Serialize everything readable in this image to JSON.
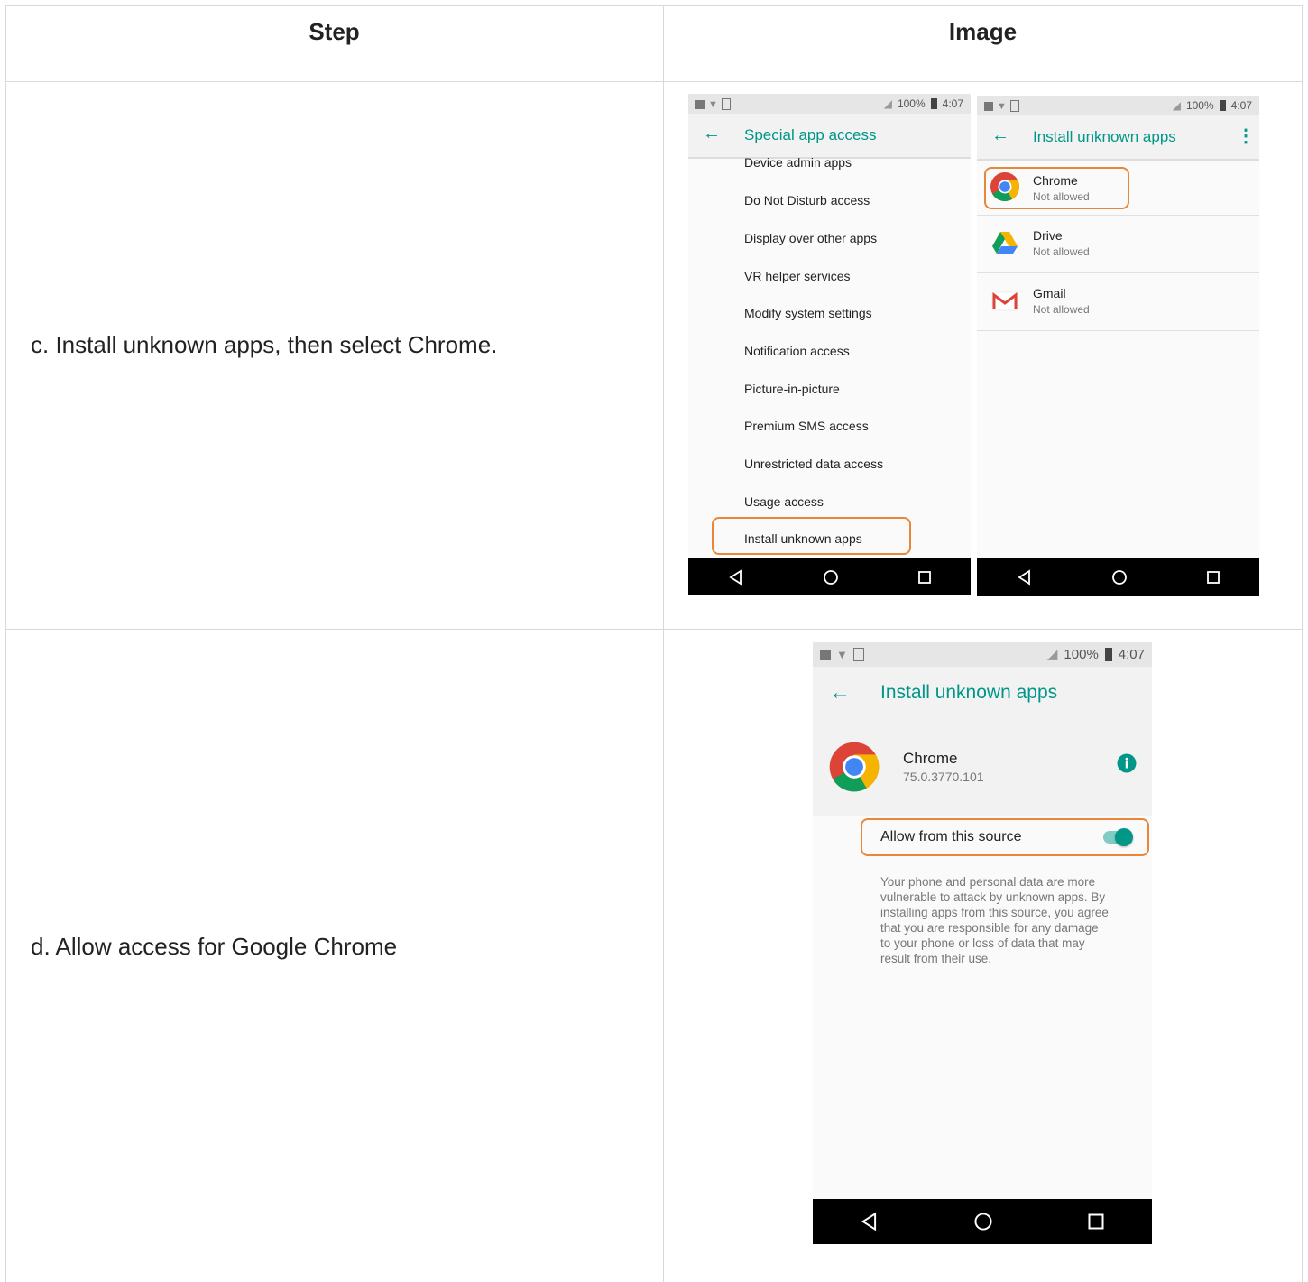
{
  "table": {
    "headers": [
      "Step",
      "Image"
    ],
    "rows": [
      {
        "step": "c.  Install unknown apps, then select Chrome."
      },
      {
        "step": "d. Allow access for Google Chrome"
      }
    ]
  },
  "status": {
    "battery": "100%",
    "time": "4:07"
  },
  "screen1": {
    "title": "Special app access",
    "items": [
      "Device admin apps",
      "Do Not Disturb access",
      "Display over other apps",
      "VR helper services",
      "Modify system settings",
      "Notification access",
      "Picture-in-picture",
      "Premium SMS access",
      "Unrestricted data access",
      "Usage access",
      "Install unknown apps"
    ]
  },
  "screen2": {
    "title": "Install unknown apps",
    "apps": [
      {
        "name": "Chrome",
        "status": "Not allowed",
        "icon": "chrome-icon"
      },
      {
        "name": "Drive",
        "status": "Not allowed",
        "icon": "drive-icon"
      },
      {
        "name": "Gmail",
        "status": "Not allowed",
        "icon": "gmail-icon"
      }
    ]
  },
  "screen3": {
    "title": "Install unknown apps",
    "app_name": "Chrome",
    "app_version": "75.0.3770.101",
    "toggle_label": "Allow from this source",
    "toggle_on": true,
    "warning_lines": [
      "Your phone and personal data are more",
      "vulnerable to attack by unknown apps. By",
      "installing apps from this source, you agree",
      "that you are responsible for any damage",
      "to your phone or loss of data that may",
      "result from their use."
    ]
  },
  "colors": {
    "accent": "#009688",
    "highlight": "#e8873a"
  }
}
